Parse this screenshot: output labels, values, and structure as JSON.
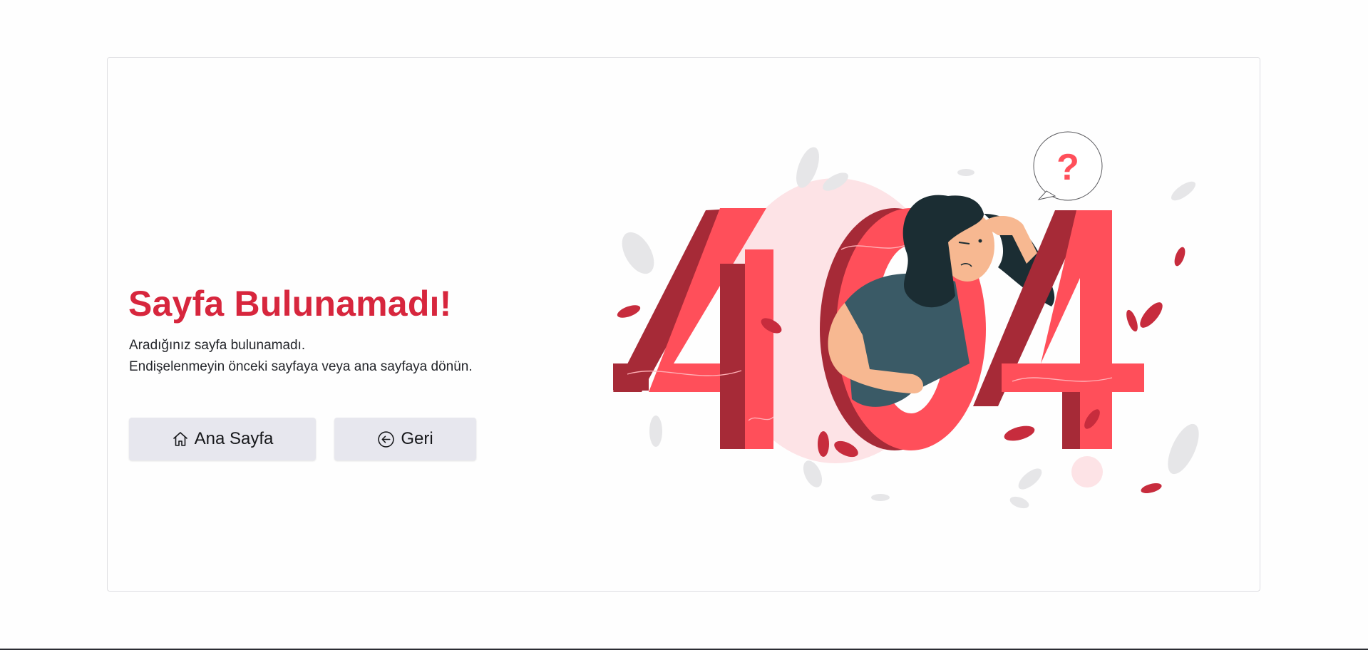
{
  "page": {
    "title": "Sayfa Bulunamadı!",
    "description_line1": "Aradığınız sayfa bulunamadı.",
    "description_line2": "Endişelenmeyin önceki sayfaya veya ana sayfaya dönün."
  },
  "buttons": {
    "home": {
      "label": "Ana Sayfa",
      "icon": "house-icon"
    },
    "back": {
      "label": "Geri",
      "icon": "arrow-left-circle-icon"
    }
  },
  "illustration": {
    "error_code": "404",
    "bubble_text": "?"
  },
  "colors": {
    "title": "#d7263d",
    "accent": "#ff4f5a",
    "accent_dark": "#b02b3a",
    "button_bg": "#e7e7ee"
  }
}
